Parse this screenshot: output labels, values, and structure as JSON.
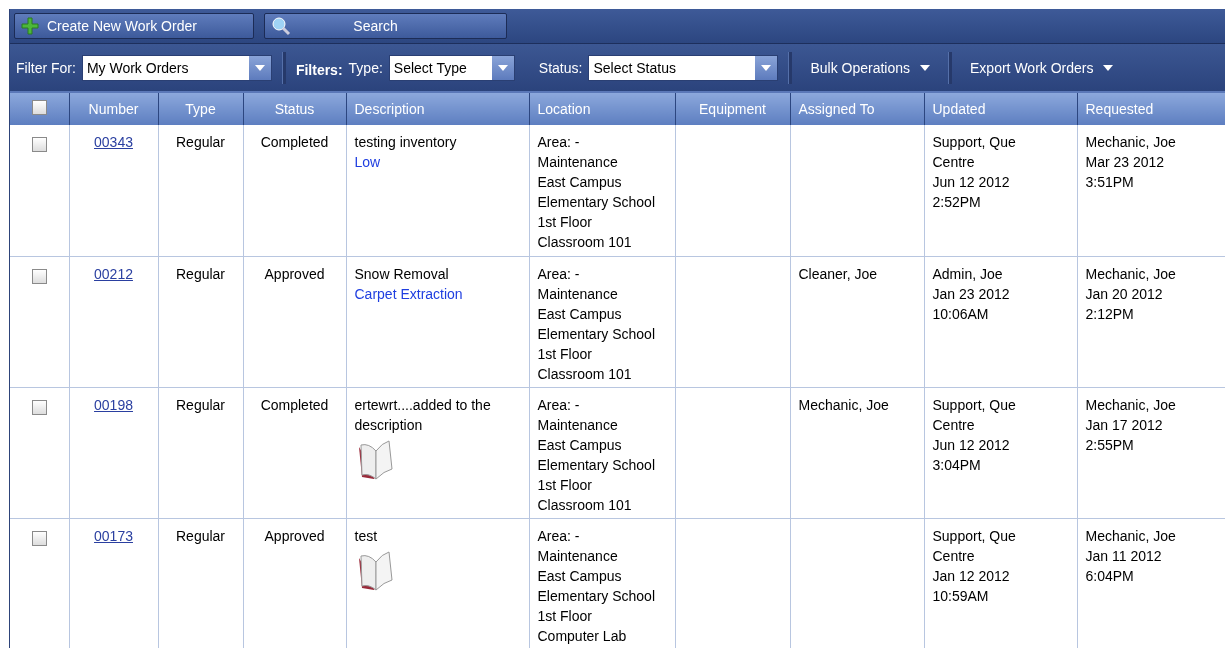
{
  "toolbar": {
    "buttons": [
      {
        "kind": "create",
        "label": "Create New Work Order"
      },
      {
        "kind": "search",
        "label": "Search"
      }
    ]
  },
  "filter_bar": {
    "filter_for": {
      "label": "Filter For:",
      "value": "My Work Orders"
    },
    "filters_label": "Filters:",
    "type": {
      "label": "Type:",
      "value": "Select Type"
    },
    "status": {
      "label": "Status:",
      "value": "Select Status"
    },
    "menus": [
      "Bulk Operations",
      "Export Work Orders"
    ]
  },
  "table": {
    "select_all": {
      "checked": false
    },
    "columns": [
      "Number",
      "Type",
      "Status",
      "Description",
      "Location",
      "Equipment",
      "Assigned To",
      "Updated",
      "Requested"
    ],
    "rows": [
      {
        "checked": false,
        "number": "00343",
        "type": "Regular",
        "status": "Completed",
        "description": "testing inventory",
        "tag": "Low",
        "attachment": false,
        "location": [
          "Area: -",
          "Maintenance",
          "East Campus",
          "Elementary School",
          "1st Floor",
          "Classroom 101"
        ],
        "assigned_to": "",
        "updated": [
          "Support, Que",
          "Centre",
          "Jun 12 2012",
          "2:52PM"
        ],
        "requested": [
          "Mechanic, Joe",
          "Mar 23 2012",
          "3:51PM"
        ]
      },
      {
        "checked": false,
        "number": "00212",
        "type": "Regular",
        "status": "Approved",
        "description": "Snow Removal",
        "tag": "Carpet Extraction",
        "attachment": false,
        "location": [
          "Area: -",
          "Maintenance",
          "East Campus",
          "Elementary School",
          "1st Floor",
          "Classroom 101"
        ],
        "assigned_to": "Cleaner, Joe",
        "updated": [
          "Admin, Joe",
          "Jan 23 2012",
          "10:06AM"
        ],
        "requested": [
          "Mechanic, Joe",
          "Jan 20 2012",
          "2:12PM"
        ]
      },
      {
        "checked": false,
        "number": "00198",
        "type": "Regular",
        "status": "Completed",
        "description": "ertewrt....added to the description",
        "attachment": true,
        "location": [
          "Area: -",
          "Maintenance",
          "East Campus",
          "Elementary School",
          "1st Floor",
          "Classroom 101"
        ],
        "assigned_to": "Mechanic, Joe",
        "updated": [
          "Support, Que",
          "Centre",
          "Jun 12 2012",
          "3:04PM"
        ],
        "requested": [
          "Mechanic, Joe",
          "Jan 17 2012",
          "2:55PM"
        ]
      },
      {
        "checked": false,
        "number": "00173",
        "type": "Regular",
        "status": "Approved",
        "description": "test",
        "attachment": true,
        "location": [
          "Area: -",
          "Maintenance",
          "East Campus",
          "Elementary School",
          "1st Floor",
          "Computer Lab"
        ],
        "assigned_to": "",
        "updated": [
          "Support, Que",
          "Centre",
          "Jan 12 2012",
          "10:59AM"
        ],
        "requested": [
          "Mechanic, Joe",
          "Jan 11 2012",
          "6:04PM"
        ]
      }
    ]
  }
}
